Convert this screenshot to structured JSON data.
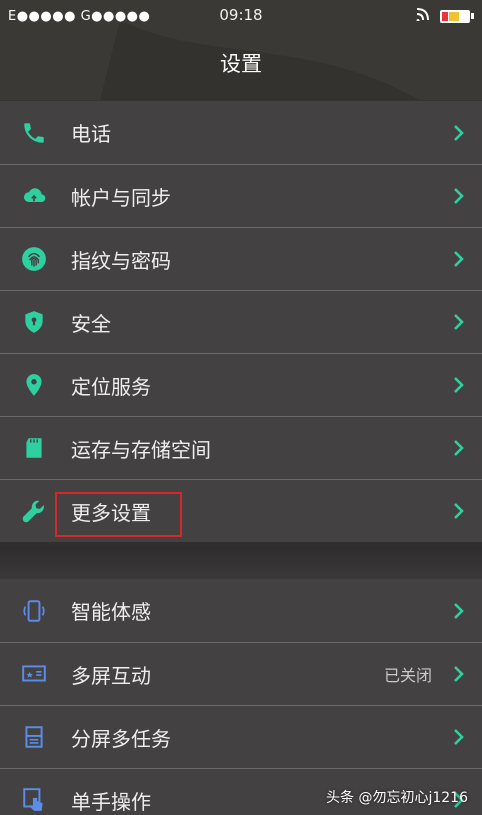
{
  "status_bar": {
    "carriers": "E●●●●● G●●●●●",
    "time": "09:18"
  },
  "header": {
    "title": "设置"
  },
  "group1": {
    "items": [
      {
        "label": "电话",
        "icon": "phone-icon"
      },
      {
        "label": "帐户与同步",
        "icon": "cloud-sync-icon"
      },
      {
        "label": "指纹与密码",
        "icon": "fingerprint-icon"
      },
      {
        "label": "安全",
        "icon": "shield-icon"
      },
      {
        "label": "定位服务",
        "icon": "location-pin-icon"
      },
      {
        "label": "运存与存储空间",
        "icon": "sd-card-icon"
      },
      {
        "label": "更多设置",
        "icon": "wrench-icon"
      }
    ]
  },
  "group2": {
    "items": [
      {
        "label": "智能体感",
        "icon": "phone-gesture-icon"
      },
      {
        "label": "多屏互动",
        "icon": "screen-cast-icon",
        "status": "已关闭"
      },
      {
        "label": "分屏多任务",
        "icon": "split-screen-icon"
      },
      {
        "label": "单手操作",
        "icon": "one-hand-icon"
      }
    ]
  },
  "watermark": "头条 @勿忘初心j1216",
  "colors": {
    "accent_green": "#2ed0a0",
    "accent_blue": "#5b8de6",
    "chevron": "#2ed0a0",
    "highlight": "#d9262b"
  }
}
